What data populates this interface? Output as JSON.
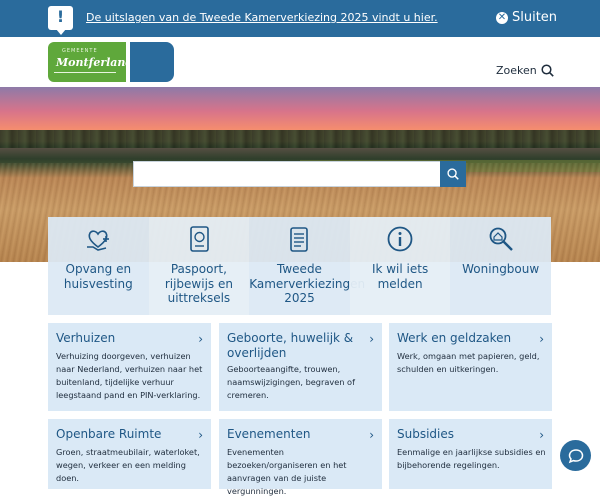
{
  "banner": {
    "message": "De uitslagen van de Tweede Kamerverkiezing 2025 vindt u hier.",
    "close_label": "Sluiten",
    "bg_color": "#2a6b9c"
  },
  "header": {
    "logo_text": "Montferland",
    "logo_small": "GEMEENTE",
    "search_label": "Zoeken"
  },
  "search": {
    "placeholder": "",
    "button_icon": "search-icon"
  },
  "tiles": [
    {
      "label": "Opvang en huisvesting",
      "icon": "heart-hand-icon"
    },
    {
      "label": "Paspoort, rijbewijs en uittreksels",
      "icon": "passport-icon"
    },
    {
      "label": "Tweede Kamerverkiezingen 2025",
      "icon": "document-list-icon"
    },
    {
      "label": "Ik wil iets melden",
      "icon": "info-icon"
    },
    {
      "label": "Woningbouw",
      "icon": "magnifier-house-icon"
    }
  ],
  "cards": [
    {
      "title": "Verhuizen",
      "desc": "Verhuizing doorgeven, verhuizen naar Nederland, verhuizen naar het buitenland, tijdelijke verhuur leegstaand pand en PIN-verklaring."
    },
    {
      "title": "Geboorte, huwelijk & overlijden",
      "desc": "Geboorteaangifte, trouwen, naamswijzigingen, begraven of cremeren."
    },
    {
      "title": "Werk en geldzaken",
      "desc": "Werk, omgaan met papieren, geld, schulden en uitkeringen."
    },
    {
      "title": "Openbare Ruimte",
      "desc": "Groen, straatmeubilair, waterloket, wegen, verkeer en een melding doen."
    },
    {
      "title": "Evenementen",
      "desc": "Evenementen bezoeken/organiseren en het aanvragen van de juiste vergunningen."
    },
    {
      "title": "Subsidies",
      "desc": "Eenmalige en jaarlijkse subsidies en bijbehorende regelingen."
    }
  ],
  "chat": {
    "icon": "chat-bubble-icon"
  }
}
